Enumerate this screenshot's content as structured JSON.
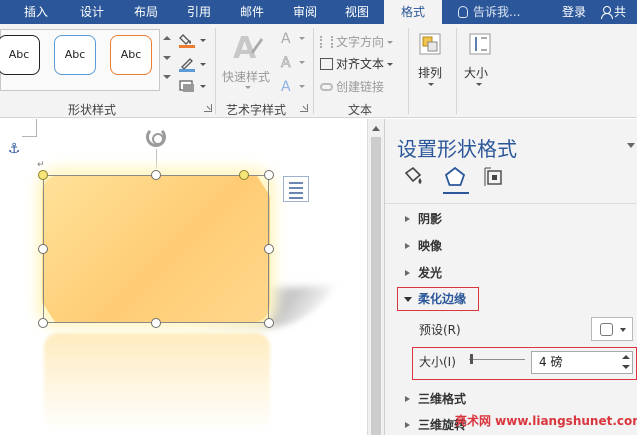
{
  "tabs": [
    {
      "label": "插入",
      "active": false
    },
    {
      "label": "设计",
      "active": false
    },
    {
      "label": "布局",
      "active": false
    },
    {
      "label": "引用",
      "active": false
    },
    {
      "label": "邮件",
      "active": false
    },
    {
      "label": "审阅",
      "active": false
    },
    {
      "label": "视图",
      "active": false
    },
    {
      "label": "格式",
      "active": true
    }
  ],
  "tell_me": "告诉我...",
  "login": "登录",
  "share": "共",
  "ribbon": {
    "shape_styles": {
      "label": "形状样式",
      "samples": [
        "Abc",
        "Abc",
        "Abc"
      ],
      "sample_border_colors": [
        "#222222",
        "#5b9bd5",
        "#ed7d31"
      ]
    },
    "art_styles": {
      "label": "艺术字样式",
      "quick_styles": "快速样式"
    },
    "text": {
      "label": "文本",
      "direction": "文字方向",
      "align": "对齐文本",
      "link": "创建链接"
    },
    "arrange": "排列",
    "size": "大小"
  },
  "pane": {
    "title": "设置形状格式",
    "sections": {
      "shadow": "阴影",
      "reflection": "映像",
      "glow": "发光",
      "soft_edges": "柔化边缘",
      "format_3d": "三维格式",
      "rotation_3d": "三维旋转"
    },
    "preset_label": "预设(R)",
    "size_label": "大小(I)",
    "size_value": "4 磅",
    "size_slider_fraction": 0.04
  },
  "watermark": "亮术网 www.liangshunet.com",
  "colors": {
    "accent": "#2b579a",
    "highlight_red": "#d9363e"
  },
  "icons": {
    "fill": "paint-bucket-icon",
    "effects": "pentagon-effects-icon",
    "layout": "layout-properties-icon",
    "rotate": "rotate-handle-icon",
    "anchor": "anchor-icon"
  }
}
